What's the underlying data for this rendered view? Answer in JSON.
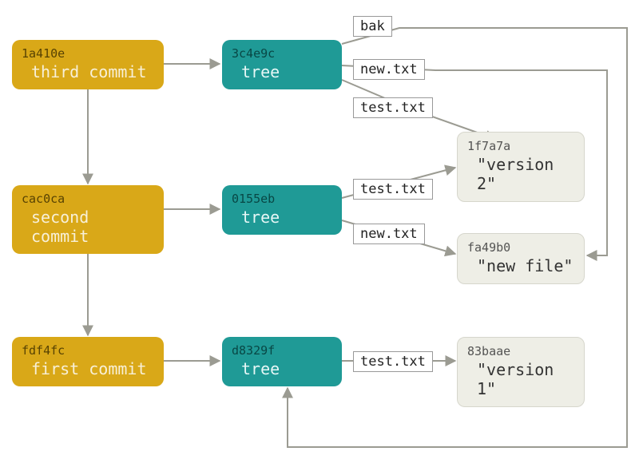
{
  "commits": {
    "third": {
      "hash": "1a410e",
      "label": "third commit"
    },
    "second": {
      "hash": "cac0ca",
      "label": "second commit"
    },
    "first": {
      "hash": "fdf4fc",
      "label": "first commit"
    }
  },
  "trees": {
    "t3": {
      "hash": "3c4e9c",
      "label": "tree"
    },
    "t2": {
      "hash": "0155eb",
      "label": "tree"
    },
    "t1": {
      "hash": "d8329f",
      "label": "tree"
    }
  },
  "blobs": {
    "v2": {
      "hash": "1f7a7a",
      "label": "\"version 2\""
    },
    "new": {
      "hash": "fa49b0",
      "label": "\"new file\""
    },
    "v1": {
      "hash": "83baae",
      "label": "\"version 1\""
    }
  },
  "edgeLabels": {
    "t3_bak": "bak",
    "t3_new": "new.txt",
    "t3_test": "test.txt",
    "t2_test": "test.txt",
    "t2_new": "new.txt",
    "t1_test": "test.txt"
  }
}
